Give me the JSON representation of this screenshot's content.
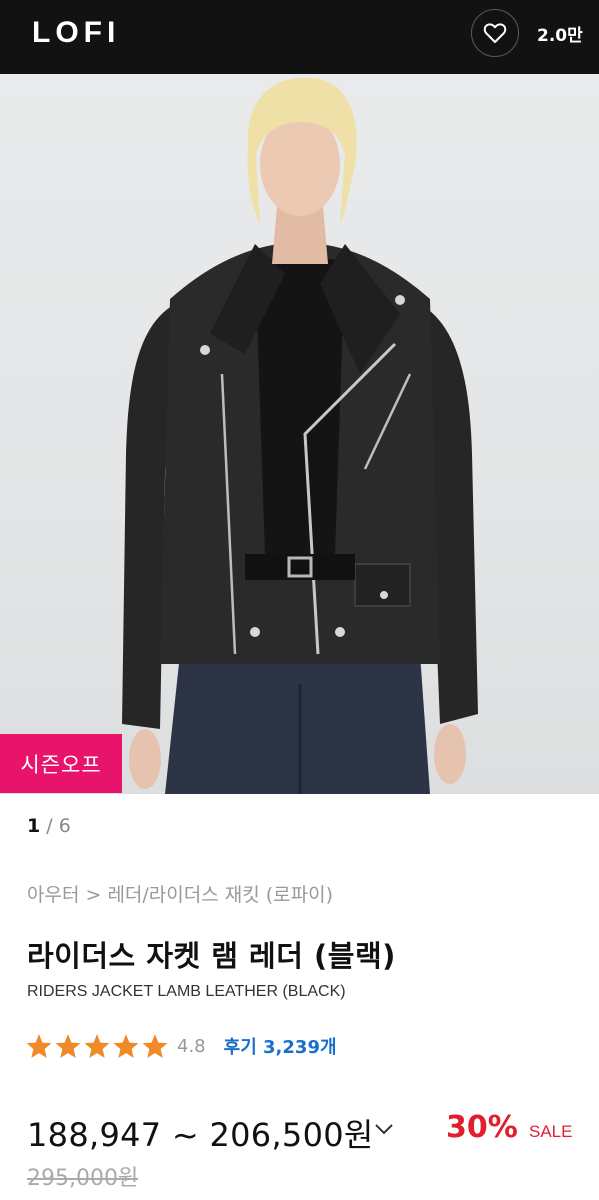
{
  "header": {
    "logo": "LOFI",
    "likes_count": "2.0만"
  },
  "gallery": {
    "badge": "시즌오프",
    "current": "1",
    "separator": " / ",
    "total": "6"
  },
  "product": {
    "category": "아우터 > 레더/라이더스 재킷 (로파이)",
    "title": "라이더스 자켓 램 레더 (블랙)",
    "subtitle": "RIDERS JACKET LAMB LEATHER (BLACK)",
    "rating": "4.8",
    "reviews": "후기 3,239개",
    "price_range": "188,947 ~ 206,500원",
    "discount": "30%",
    "sale_label": "SALE",
    "original_price": "295,000원"
  },
  "colors": {
    "header_bg": "#121212",
    "badge_bg": "#e8146c",
    "star": "#f08a28",
    "review_link": "#1a6fc9",
    "discount": "#e01e2c"
  }
}
